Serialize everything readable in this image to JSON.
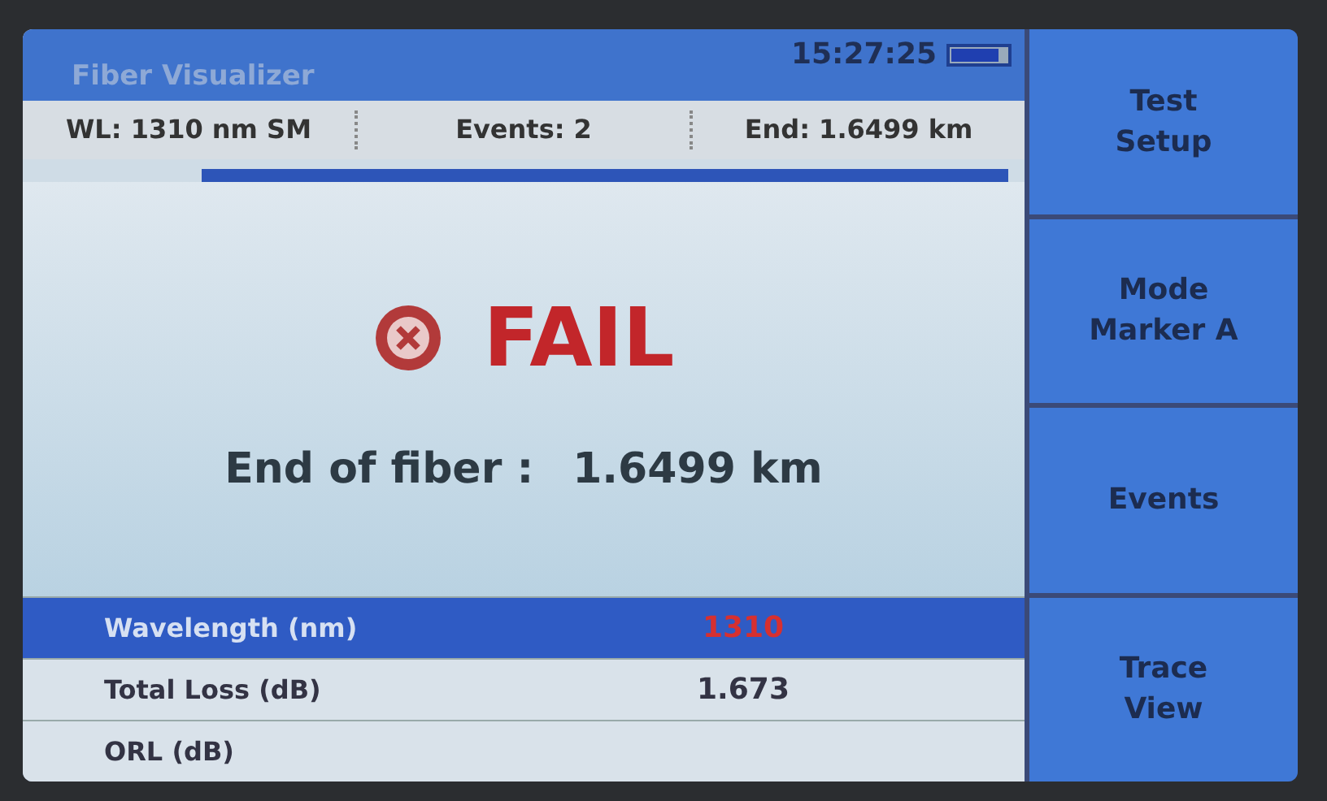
{
  "title_bar": {
    "title": "Fiber Visualizer",
    "time": "15:27:25"
  },
  "info_bar": [
    {
      "text": "WL: 1310 nm SM"
    },
    {
      "text": "Events: 2"
    },
    {
      "text": "End: 1.6499 km"
    }
  ],
  "result": {
    "status": "FAIL",
    "passed": false,
    "end_label": "End of fiber :",
    "end_value": "1.6499 km"
  },
  "table": {
    "rows": [
      {
        "label": "Wavelength (nm)",
        "value": "1310",
        "selected": true
      },
      {
        "label": "Total Loss (dB)",
        "value": "1.673",
        "selected": false
      },
      {
        "label": "ORL (dB)",
        "selected": false
      }
    ]
  },
  "softkeys": [
    {
      "label": "Test Setup"
    },
    {
      "label": "Mode Marker A"
    },
    {
      "label": "Events"
    },
    {
      "label": "Trace View"
    }
  ]
}
